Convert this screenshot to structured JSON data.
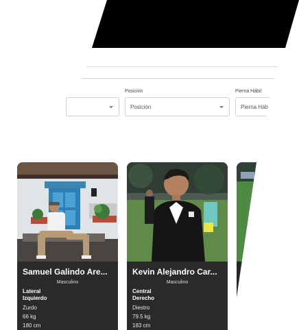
{
  "filters": {
    "position": {
      "label": "Posición",
      "value": "Posición"
    },
    "foot": {
      "label": "Pierna Hábil",
      "value": "Pierna Hábil"
    }
  },
  "players": [
    {
      "name": "Samuel Galindo Are...",
      "gender": "Masculino",
      "position_line1": "Lateral",
      "position_line2": "Izquierdo",
      "foot": "Zurdo",
      "weight": "66 kg",
      "height": "180 cm"
    },
    {
      "name": "Kevin Alejandro Car...",
      "gender": "Masculino",
      "position_line1": "Central",
      "position_line2": "Derecho",
      "foot": "Diestro",
      "weight": "79.5 kg",
      "height": "183 cm"
    }
  ],
  "colors": {
    "banner": "#000000",
    "card_bg": "#2a2a2a",
    "border": "#cfcfcf"
  }
}
